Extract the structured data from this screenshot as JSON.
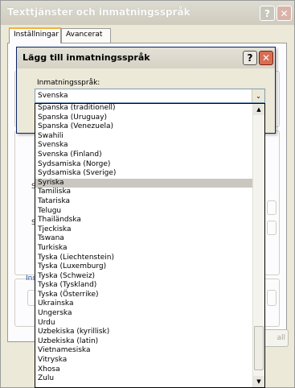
{
  "background_window": {
    "title": "Texttjänster och inmatningsspråk",
    "tabs": [
      {
        "label": "Inställningar"
      },
      {
        "label": "Avancerat"
      }
    ],
    "partial_labels": {
      "s1": "S",
      "s2": "S",
      "ins": "Ins"
    },
    "apply_button_partial": "all"
  },
  "dialog": {
    "title": "Lägg till inmatningsspråk",
    "help_glyph": "?",
    "close_glyph": "✕",
    "input_language_label": "Inmatningsspråk:",
    "input_language_value": "Svenska",
    "dropdown_arrow": "⌄"
  },
  "dropdown": {
    "options": [
      "Spanska (traditionell)",
      "Spanska (Uruguay)",
      "Spanska (Venezuela)",
      "Swahili",
      "Svenska",
      "Svenska (Finland)",
      "Sydsamiska (Norge)",
      "Sydsamiska (Sverige)",
      "Syriska",
      "Tamiliska",
      "Tatariska",
      "Telugu",
      "Thailändska",
      "Tjeckiska",
      "Tswana",
      "Turkiska",
      "Tyska (Liechtenstein)",
      "Tyska (Luxemburg)",
      "Tyska (Schweiz)",
      "Tyska (Tyskland)",
      "Tyska (Österrike)",
      "Ukrainska",
      "Ungerska",
      "Urdu",
      "Uzbekiska (kyrillisk)",
      "Uzbekiska (latin)",
      "Vietnamesiska",
      "Vitryska",
      "Xhosa",
      "Zulu"
    ],
    "highlighted_option": "Syriska",
    "scroll_up_glyph": "▲",
    "scroll_down_glyph": "▼"
  },
  "colors": {
    "highlight": "#c9c7c0",
    "window_face": "#ece9d8",
    "close_button": "#d96d52"
  }
}
